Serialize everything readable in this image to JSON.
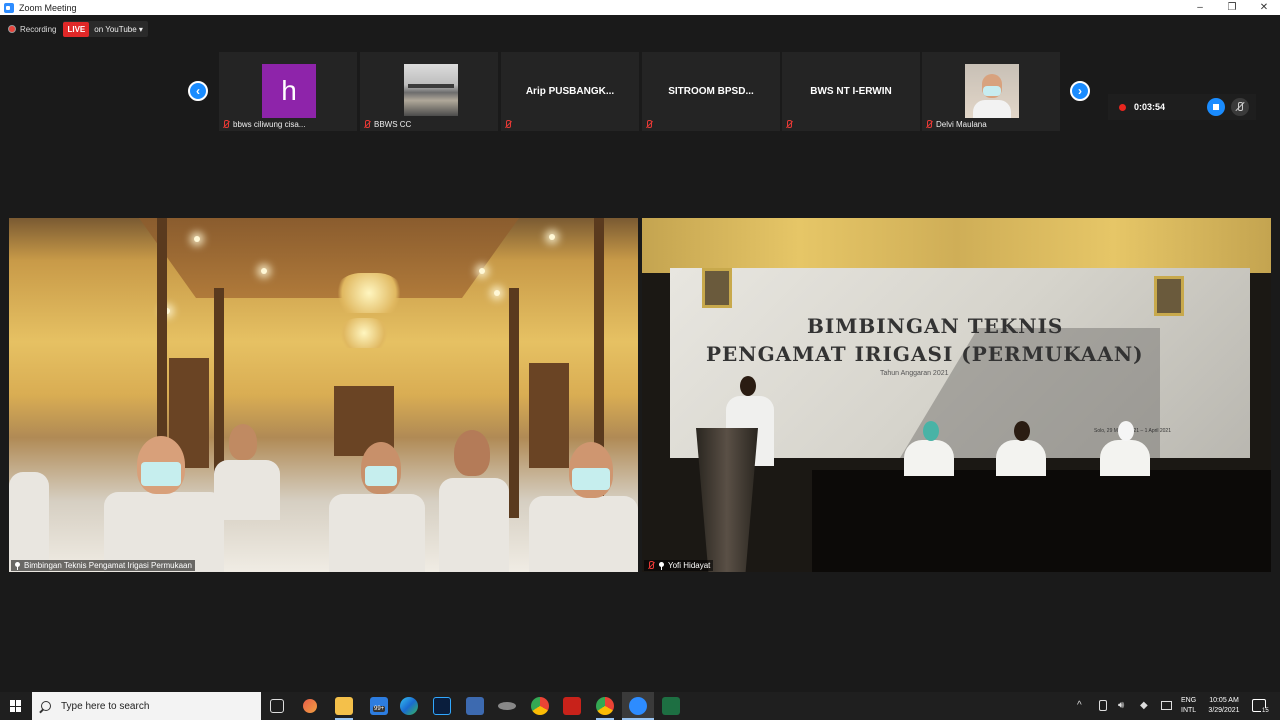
{
  "window": {
    "title": "Zoom Meeting",
    "minimize": "–",
    "maximize": "❐",
    "close": "✕"
  },
  "recording_bar": {
    "recording_label": "Recording",
    "live_badge": "LIVE",
    "stream_label": "on YouTube",
    "stream_caret": "▾"
  },
  "strip": {
    "prev_arrow": "‹",
    "next_arrow": "›",
    "thumbnails": [
      {
        "caption": "bbws ciliwung cisa...",
        "avatar_letter": "h",
        "avatar_color": "#8e24aa",
        "muted": true
      },
      {
        "caption": "BBWS CC",
        "muted": true
      },
      {
        "center_name": "Arip  PUSBANGK...",
        "muted": true
      },
      {
        "center_name": "SITROOM  BPSD...",
        "muted": true
      },
      {
        "center_name": "BWS NT I-ERWIN",
        "muted": true
      },
      {
        "caption": "Delvi Maulana",
        "muted": true
      }
    ]
  },
  "recording_timer": {
    "elapsed": "0:03:54"
  },
  "videos": {
    "left": {
      "caption": "Bimbingan Teknis Pengamat Irigasi Permukaan"
    },
    "right": {
      "caption": "Yofi Hidayat",
      "banner_line1": "BIMBINGAN TEKNIS",
      "banner_line2": "PENGAMAT IRIGASI (PERMUKAAN)",
      "banner_line3": "Tahun Anggaran 2021",
      "banner_line4": "Solo, 29 Maret 2021 – 1 April 2021"
    }
  },
  "taskbar": {
    "search_placeholder": "Type here to search",
    "mail_badge": "99+",
    "tray_language": "ENG",
    "tray_layout": "INTL",
    "clock_time": "10:05 AM",
    "clock_date": "3/29/2021",
    "notification_count": "15"
  },
  "colors": {
    "accent": "#1a8cff",
    "live": "#e02828",
    "rec": "#e8261e",
    "muted": "#e53935"
  }
}
